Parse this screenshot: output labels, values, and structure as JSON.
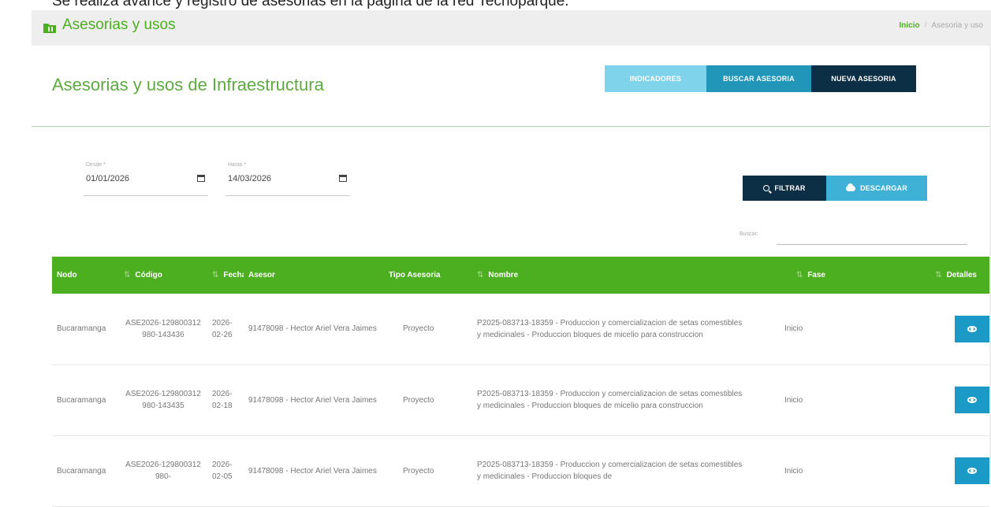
{
  "caption": "Se realiza avance y registro de asesorias en la pagina de la red Tecnoparque.",
  "header": {
    "title": "Asesorias y usos",
    "breadcrumb_home": "Inicio",
    "breadcrumb_current": "Asesoria y uso"
  },
  "card": {
    "title": "Asesorias y usos de Infraestructura",
    "btn_indicadores": "INDICADORES",
    "btn_buscar": "BUSCAR ASESORIA",
    "btn_nueva": "NUEVA ASESORIA"
  },
  "filters": {
    "desde_label": "Desde *",
    "desde_value": "01/01/2026",
    "hasta_label": "Hasta *",
    "hasta_value": "14/03/2026",
    "btn_filtrar": "FILTRAR",
    "btn_descargar": "DESCARGAR",
    "search_label": "Buscar:"
  },
  "table": {
    "columns": [
      "Nodo",
      "Código",
      "Fecha",
      "Asesor",
      "Tipo Asesoria",
      "Nombre",
      "Fase",
      "Detalles"
    ],
    "rows": [
      {
        "nodo": "Bucaramanga",
        "codigo": "ASE2026-129800312980-143436",
        "fecha": "2026-02-26",
        "asesor": "91478098 - Hector Ariel Vera Jaimes",
        "tipo": "Proyecto",
        "nombre": "P2025-083713-18359 - Produccion y comercializacion de setas comestibles y medicinales - Produccion bloques de micelio para construccion",
        "fase": "Inicio"
      },
      {
        "nodo": "Bucaramanga",
        "codigo": "ASE2026-129800312980-143435",
        "fecha": "2026-02-18",
        "asesor": "91478098 - Hector Ariel Vera Jaimes",
        "tipo": "Proyecto",
        "nombre": "P2025-083713-18359 - Produccion y comercializacion de setas comestibles y medicinales - Produccion bloques de micelio para construccion",
        "fase": "Inicio"
      },
      {
        "nodo": "Bucaramanga",
        "codigo": "ASE2026-129800312980-",
        "fecha": "2026-02-05",
        "asesor": "91478098 - Hector Ariel Vera Jaimes",
        "tipo": "Proyecto",
        "nombre": "P2025-083713-18359 - Produccion y comercializacion de setas comestibles y medicinales - Produccion bloques de",
        "fase": "Inicio"
      }
    ]
  },
  "colors": {
    "brand_green": "#4caf1f",
    "dark_navy": "#0d2f45",
    "cyan": "#2196b8",
    "light_cyan": "#7fd3ea"
  }
}
